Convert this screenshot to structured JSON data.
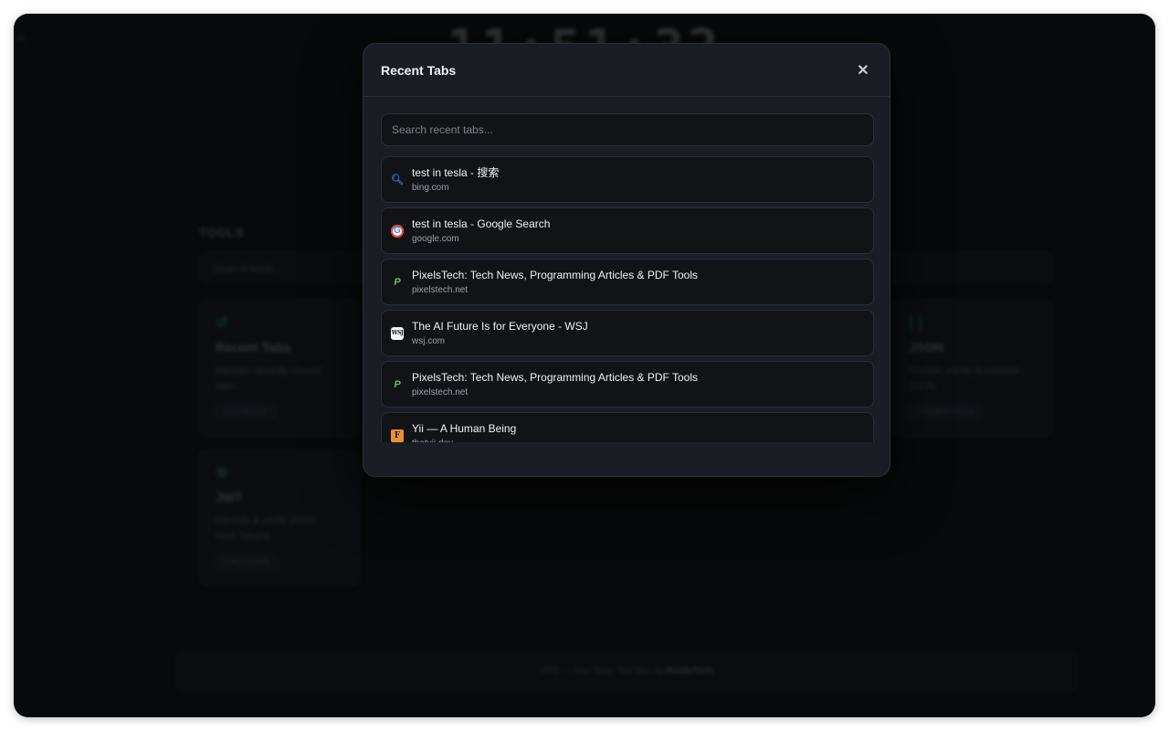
{
  "background": {
    "corner_text": "ch",
    "clock": "11:51:32",
    "tools_heading": "TOOLS",
    "tools_search_placeholder": "Search tools...",
    "cards": [
      {
        "icon": "history-icon",
        "name": "Recent Tabs",
        "desc": "Reopen recently closed tabs",
        "tag": "BROWSER"
      },
      {
        "icon": "braces-icon",
        "name": "JSON",
        "desc": "Format, minify & validate JSON",
        "tag": "FORMATTING"
      },
      {
        "icon": "globe-icon",
        "name": "JWT",
        "desc": "Decode & verify JSON Web Tokens",
        "tag": "ENCODING"
      }
    ],
    "footer_prefix": "DTB — Your Daily Tool Box by ",
    "footer_brand": "PixelsTech"
  },
  "modal": {
    "title": "Recent Tabs",
    "close_glyph": "✕",
    "search_placeholder": "Search recent tabs...",
    "tabs": [
      {
        "favicon": "bing",
        "glyph": "🔍︎",
        "title": "test in tesla - 搜索",
        "domain": "bing.com"
      },
      {
        "favicon": "google",
        "glyph": "G",
        "title": "test in tesla - Google Search",
        "domain": "google.com"
      },
      {
        "favicon": "pixels",
        "glyph": "P",
        "title": "PixelsTech: Tech News, Programming Articles & PDF Tools",
        "domain": "pixelstech.net"
      },
      {
        "favicon": "wsj",
        "glyph": "WSJ",
        "title": "The AI Future Is for Everyone - WSJ",
        "domain": "wsj.com"
      },
      {
        "favicon": "pixels",
        "glyph": "P",
        "title": "PixelsTech: Tech News, Programming Articles & PDF Tools",
        "domain": "pixelstech.net"
      },
      {
        "favicon": "yii",
        "glyph": "F",
        "title": "Yii — A Human Being",
        "domain": "thatyii.dev"
      }
    ]
  },
  "colors": {
    "modal_bg": "#1a1d24",
    "item_bg": "#111317",
    "accent_green": "#27643b"
  }
}
